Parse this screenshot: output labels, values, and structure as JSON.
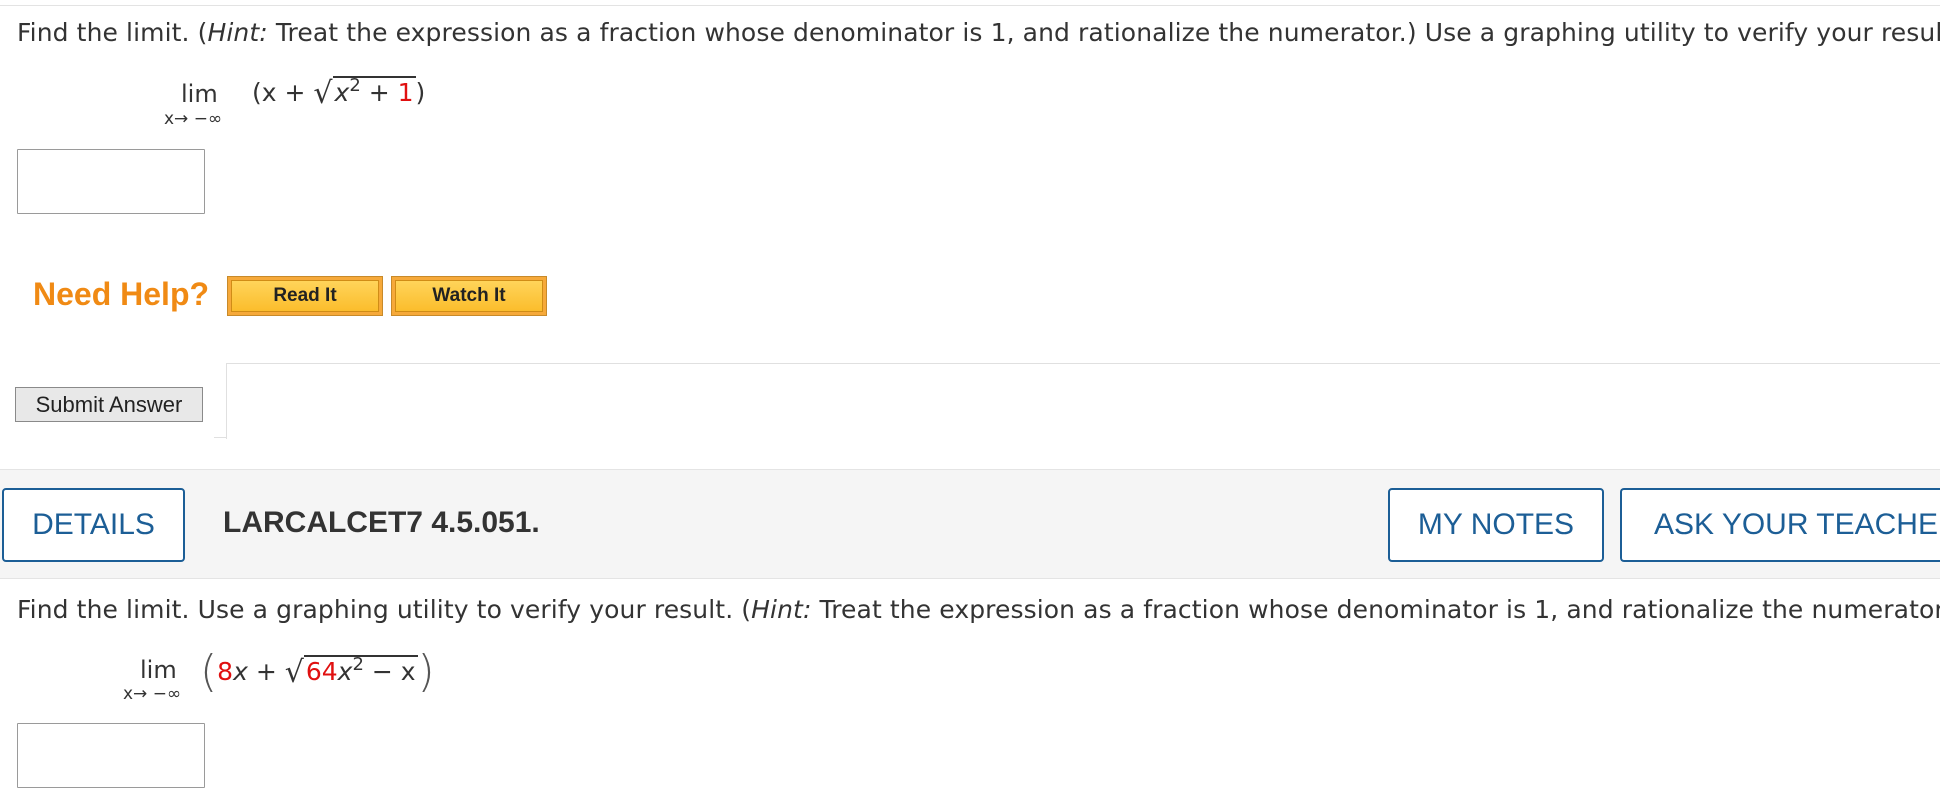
{
  "question1": {
    "prompt_before": "Find the limit. (",
    "prompt_hint": "Hint:",
    "prompt_after": " Treat the expression as a fraction whose denominator is 1, and rationalize the numerator.) Use a graphing utility to verify your result.",
    "lim": "lim",
    "lim_sub": "x→ −∞",
    "expr_open": "(x + ",
    "radicand_var": "x",
    "radicand_exp": "2",
    "radicand_plus": " + ",
    "radicand_const": "1",
    "expr_close": ")",
    "answer_value": ""
  },
  "help": {
    "label": "Need Help?",
    "read_it": "Read It",
    "watch_it": "Watch It"
  },
  "submit": {
    "label": "Submit Answer"
  },
  "question2_header": {
    "details": "DETAILS",
    "id": "LARCALCET7 4.5.051.",
    "my_notes": "MY NOTES",
    "ask_teacher": "ASK YOUR TEACHER"
  },
  "question2": {
    "prompt_before": "Find the limit. Use a graphing utility to verify your result. (",
    "prompt_hint": "Hint:",
    "prompt_after": " Treat the expression as a fraction whose denominator is 1, and rationalize the numerator.)",
    "lim": "lim",
    "lim_sub": "x→ −∞",
    "coef": "8",
    "var": "x",
    "plus": " + ",
    "radicand_coef": "64",
    "radicand_var": "x",
    "radicand_exp": "2",
    "radicand_minus": " − x",
    "answer_value": ""
  },
  "colors": {
    "accent_blue": "#1c5e96",
    "help_orange": "#f08a14",
    "param_red": "#e01010"
  }
}
